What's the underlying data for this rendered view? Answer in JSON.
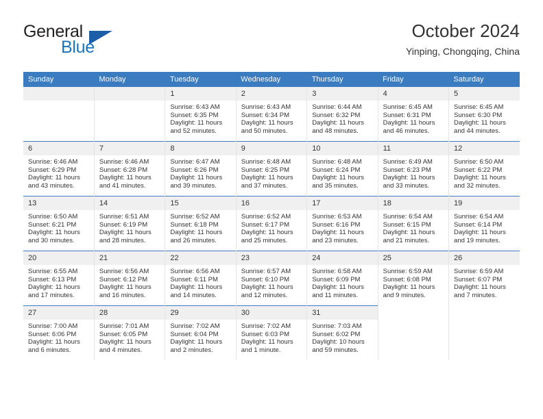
{
  "logo": {
    "word_one": "General",
    "word_two": "Blue",
    "triangle_icon": "triangle-icon",
    "color_dark": "#231f20",
    "color_blue": "#1c75bc",
    "color_triangle": "#1c5fa8"
  },
  "header": {
    "title": "October 2024",
    "subtitle": "Yinping, Chongqing, China"
  },
  "theme": {
    "header_bg": "#3b7bbf",
    "daynum_bg": "#f0f0f0",
    "text": "#333333",
    "cell_border": "#e4e4e4"
  },
  "calendar": {
    "weekday_headers": [
      "Sunday",
      "Monday",
      "Tuesday",
      "Wednesday",
      "Thursday",
      "Friday",
      "Saturday"
    ],
    "weeks": [
      [
        {
          "day": "",
          "sunrise": "",
          "sunset": "",
          "daylight_line1": "",
          "daylight_line2": "",
          "empty": true
        },
        {
          "day": "",
          "sunrise": "",
          "sunset": "",
          "daylight_line1": "",
          "daylight_line2": "",
          "empty": true
        },
        {
          "day": "1",
          "sunrise": "Sunrise: 6:43 AM",
          "sunset": "Sunset: 6:35 PM",
          "daylight_line1": "Daylight: 11 hours",
          "daylight_line2": "and 52 minutes."
        },
        {
          "day": "2",
          "sunrise": "Sunrise: 6:43 AM",
          "sunset": "Sunset: 6:34 PM",
          "daylight_line1": "Daylight: 11 hours",
          "daylight_line2": "and 50 minutes."
        },
        {
          "day": "3",
          "sunrise": "Sunrise: 6:44 AM",
          "sunset": "Sunset: 6:32 PM",
          "daylight_line1": "Daylight: 11 hours",
          "daylight_line2": "and 48 minutes."
        },
        {
          "day": "4",
          "sunrise": "Sunrise: 6:45 AM",
          "sunset": "Sunset: 6:31 PM",
          "daylight_line1": "Daylight: 11 hours",
          "daylight_line2": "and 46 minutes."
        },
        {
          "day": "5",
          "sunrise": "Sunrise: 6:45 AM",
          "sunset": "Sunset: 6:30 PM",
          "daylight_line1": "Daylight: 11 hours",
          "daylight_line2": "and 44 minutes."
        }
      ],
      [
        {
          "day": "6",
          "sunrise": "Sunrise: 6:46 AM",
          "sunset": "Sunset: 6:29 PM",
          "daylight_line1": "Daylight: 11 hours",
          "daylight_line2": "and 43 minutes."
        },
        {
          "day": "7",
          "sunrise": "Sunrise: 6:46 AM",
          "sunset": "Sunset: 6:28 PM",
          "daylight_line1": "Daylight: 11 hours",
          "daylight_line2": "and 41 minutes."
        },
        {
          "day": "8",
          "sunrise": "Sunrise: 6:47 AM",
          "sunset": "Sunset: 6:26 PM",
          "daylight_line1": "Daylight: 11 hours",
          "daylight_line2": "and 39 minutes."
        },
        {
          "day": "9",
          "sunrise": "Sunrise: 6:48 AM",
          "sunset": "Sunset: 6:25 PM",
          "daylight_line1": "Daylight: 11 hours",
          "daylight_line2": "and 37 minutes."
        },
        {
          "day": "10",
          "sunrise": "Sunrise: 6:48 AM",
          "sunset": "Sunset: 6:24 PM",
          "daylight_line1": "Daylight: 11 hours",
          "daylight_line2": "and 35 minutes."
        },
        {
          "day": "11",
          "sunrise": "Sunrise: 6:49 AM",
          "sunset": "Sunset: 6:23 PM",
          "daylight_line1": "Daylight: 11 hours",
          "daylight_line2": "and 33 minutes."
        },
        {
          "day": "12",
          "sunrise": "Sunrise: 6:50 AM",
          "sunset": "Sunset: 6:22 PM",
          "daylight_line1": "Daylight: 11 hours",
          "daylight_line2": "and 32 minutes."
        }
      ],
      [
        {
          "day": "13",
          "sunrise": "Sunrise: 6:50 AM",
          "sunset": "Sunset: 6:21 PM",
          "daylight_line1": "Daylight: 11 hours",
          "daylight_line2": "and 30 minutes."
        },
        {
          "day": "14",
          "sunrise": "Sunrise: 6:51 AM",
          "sunset": "Sunset: 6:19 PM",
          "daylight_line1": "Daylight: 11 hours",
          "daylight_line2": "and 28 minutes."
        },
        {
          "day": "15",
          "sunrise": "Sunrise: 6:52 AM",
          "sunset": "Sunset: 6:18 PM",
          "daylight_line1": "Daylight: 11 hours",
          "daylight_line2": "and 26 minutes."
        },
        {
          "day": "16",
          "sunrise": "Sunrise: 6:52 AM",
          "sunset": "Sunset: 6:17 PM",
          "daylight_line1": "Daylight: 11 hours",
          "daylight_line2": "and 25 minutes."
        },
        {
          "day": "17",
          "sunrise": "Sunrise: 6:53 AM",
          "sunset": "Sunset: 6:16 PM",
          "daylight_line1": "Daylight: 11 hours",
          "daylight_line2": "and 23 minutes."
        },
        {
          "day": "18",
          "sunrise": "Sunrise: 6:54 AM",
          "sunset": "Sunset: 6:15 PM",
          "daylight_line1": "Daylight: 11 hours",
          "daylight_line2": "and 21 minutes."
        },
        {
          "day": "19",
          "sunrise": "Sunrise: 6:54 AM",
          "sunset": "Sunset: 6:14 PM",
          "daylight_line1": "Daylight: 11 hours",
          "daylight_line2": "and 19 minutes."
        }
      ],
      [
        {
          "day": "20",
          "sunrise": "Sunrise: 6:55 AM",
          "sunset": "Sunset: 6:13 PM",
          "daylight_line1": "Daylight: 11 hours",
          "daylight_line2": "and 17 minutes."
        },
        {
          "day": "21",
          "sunrise": "Sunrise: 6:56 AM",
          "sunset": "Sunset: 6:12 PM",
          "daylight_line1": "Daylight: 11 hours",
          "daylight_line2": "and 16 minutes."
        },
        {
          "day": "22",
          "sunrise": "Sunrise: 6:56 AM",
          "sunset": "Sunset: 6:11 PM",
          "daylight_line1": "Daylight: 11 hours",
          "daylight_line2": "and 14 minutes."
        },
        {
          "day": "23",
          "sunrise": "Sunrise: 6:57 AM",
          "sunset": "Sunset: 6:10 PM",
          "daylight_line1": "Daylight: 11 hours",
          "daylight_line2": "and 12 minutes."
        },
        {
          "day": "24",
          "sunrise": "Sunrise: 6:58 AM",
          "sunset": "Sunset: 6:09 PM",
          "daylight_line1": "Daylight: 11 hours",
          "daylight_line2": "and 11 minutes."
        },
        {
          "day": "25",
          "sunrise": "Sunrise: 6:59 AM",
          "sunset": "Sunset: 6:08 PM",
          "daylight_line1": "Daylight: 11 hours",
          "daylight_line2": "and 9 minutes."
        },
        {
          "day": "26",
          "sunrise": "Sunrise: 6:59 AM",
          "sunset": "Sunset: 6:07 PM",
          "daylight_line1": "Daylight: 11 hours",
          "daylight_line2": "and 7 minutes."
        }
      ],
      [
        {
          "day": "27",
          "sunrise": "Sunrise: 7:00 AM",
          "sunset": "Sunset: 6:06 PM",
          "daylight_line1": "Daylight: 11 hours",
          "daylight_line2": "and 6 minutes."
        },
        {
          "day": "28",
          "sunrise": "Sunrise: 7:01 AM",
          "sunset": "Sunset: 6:05 PM",
          "daylight_line1": "Daylight: 11 hours",
          "daylight_line2": "and 4 minutes."
        },
        {
          "day": "29",
          "sunrise": "Sunrise: 7:02 AM",
          "sunset": "Sunset: 6:04 PM",
          "daylight_line1": "Daylight: 11 hours",
          "daylight_line2": "and 2 minutes."
        },
        {
          "day": "30",
          "sunrise": "Sunrise: 7:02 AM",
          "sunset": "Sunset: 6:03 PM",
          "daylight_line1": "Daylight: 11 hours",
          "daylight_line2": "and 1 minute."
        },
        {
          "day": "31",
          "sunrise": "Sunrise: 7:03 AM",
          "sunset": "Sunset: 6:02 PM",
          "daylight_line1": "Daylight: 10 hours",
          "daylight_line2": "and 59 minutes."
        },
        {
          "day": "",
          "sunrise": "",
          "sunset": "",
          "daylight_line1": "",
          "daylight_line2": "",
          "empty": true,
          "none": true
        },
        {
          "day": "",
          "sunrise": "",
          "sunset": "",
          "daylight_line1": "",
          "daylight_line2": "",
          "empty": true,
          "none": true
        }
      ]
    ]
  }
}
